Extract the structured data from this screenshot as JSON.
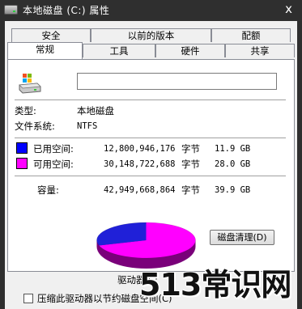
{
  "window": {
    "title": "本地磁盘 (C:) 属性",
    "close_glyph": "x"
  },
  "tabs": {
    "row1": [
      "安全",
      "以前的版本",
      "配额"
    ],
    "row2": [
      "常规",
      "工具",
      "硬件",
      "共享"
    ],
    "active": "常规"
  },
  "general": {
    "name_value": "",
    "type_label": "类型:",
    "type_value": "本地磁盘",
    "fs_label": "文件系统:",
    "fs_value": "NTFS",
    "used": {
      "label": "已用空间:",
      "bytes": "12,800,946,176",
      "unit": "字节",
      "size": "11.9 GB",
      "color": "#0000ff"
    },
    "free": {
      "label": "可用空间:",
      "bytes": "30,148,722,688",
      "unit": "字节",
      "size": "28.0 GB",
      "color": "#ff00ff"
    },
    "capacity": {
      "label": "容量:",
      "bytes": "42,949,668,864",
      "unit": "字节",
      "size": "39.9 GB"
    },
    "used_fraction": 0.298,
    "drive_label": "驱动器 C:",
    "cleanup_button": "磁盘清理(D)",
    "compress_checkbox": "压缩此驱动器以节约磁盘空间(C)",
    "compress_checked": false
  },
  "watermark": "513常识网",
  "icons": {
    "drive": "drive-icon",
    "window": "drive-icon"
  }
}
